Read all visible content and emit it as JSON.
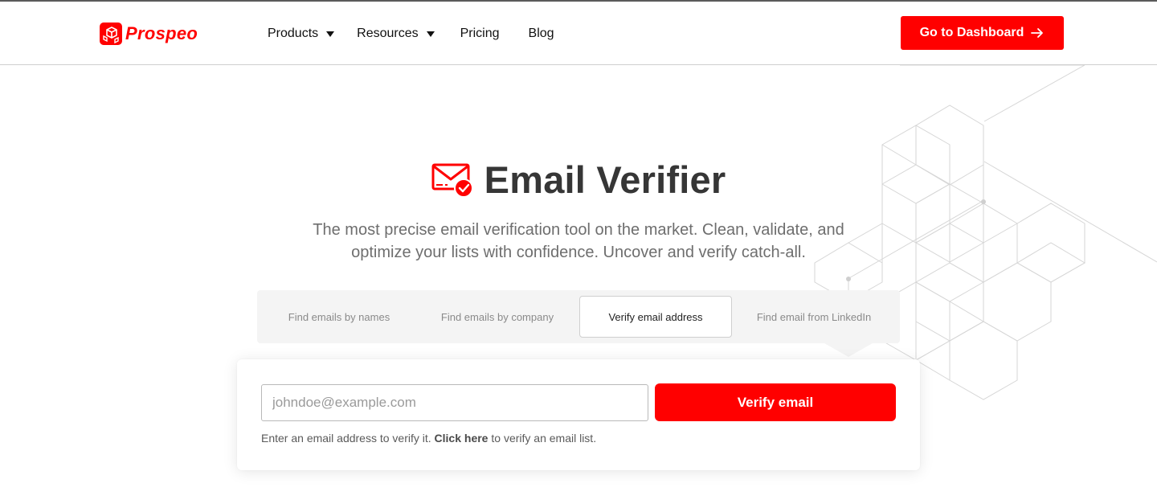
{
  "brand": {
    "name": "Prospeo",
    "accent": "#ff0000"
  },
  "nav": {
    "items": [
      {
        "label": "Products",
        "has_dropdown": true
      },
      {
        "label": "Resources",
        "has_dropdown": true
      },
      {
        "label": "Pricing",
        "has_dropdown": false
      },
      {
        "label": "Blog",
        "has_dropdown": false
      }
    ],
    "cta": {
      "label": "Go to Dashboard",
      "icon": "arrow-right-icon"
    }
  },
  "hero": {
    "icon": "email-verify-icon",
    "title": "Email Verifier",
    "subtitle_line1": "The most precise email verification tool on the market. Clean, validate, and",
    "subtitle_line2": "optimize your lists with confidence. Uncover and verify catch-all."
  },
  "tabs": [
    {
      "label": "Find emails by names",
      "active": false
    },
    {
      "label": "Find emails by company",
      "active": false
    },
    {
      "label": "Verify email address",
      "active": true
    },
    {
      "label": "Find email from LinkedIn",
      "active": false
    }
  ],
  "form": {
    "input_value": "",
    "input_placeholder": "johndoe@example.com",
    "submit_label": "Verify email",
    "helper_before": "Enter an email address to verify it. ",
    "helper_link": "Click here",
    "helper_after": " to verify an email list."
  }
}
